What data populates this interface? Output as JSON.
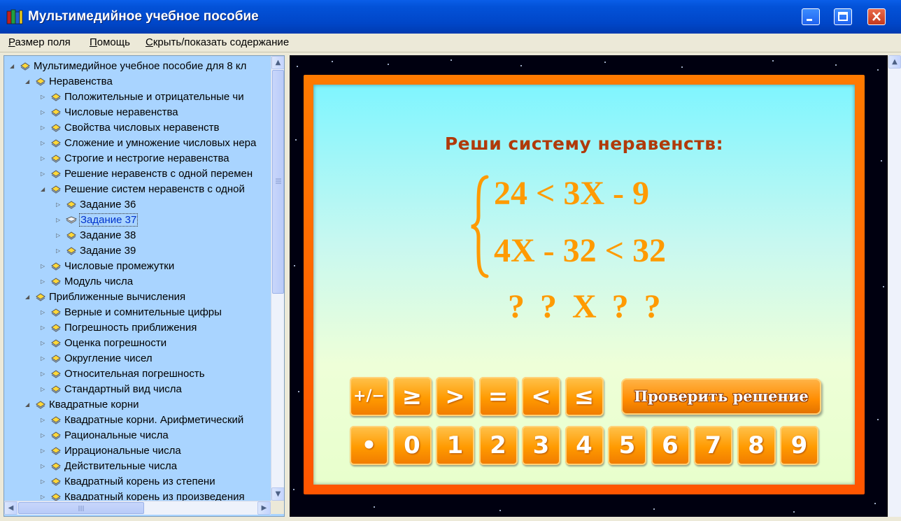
{
  "window": {
    "title": "Мультимедийное учебное пособие"
  },
  "menu": [
    {
      "label": "Размер поля",
      "underline": "Р",
      "rest": "азмер поля"
    },
    {
      "label": "Помощь",
      "underline": "П",
      "rest": "омощь"
    },
    {
      "label": "Скрыть/показать содержание",
      "underline": "С",
      "rest": "крыть/показать содержание"
    }
  ],
  "tree": {
    "items": [
      {
        "label": "Мультимедийное учебное пособие для 8 кл",
        "level": 0,
        "expanded": true
      },
      {
        "label": "Неравенства",
        "level": 1,
        "expanded": true
      },
      {
        "label": "Положительные и отрицательные чи",
        "level": 2
      },
      {
        "label": "Числовые неравенства",
        "level": 2
      },
      {
        "label": "Свойства числовых неравенств",
        "level": 2
      },
      {
        "label": "Сложение и умножение числовых нера",
        "level": 2
      },
      {
        "label": "Строгие и нестрогие неравенства",
        "level": 2
      },
      {
        "label": "Решение неравенств с одной перемен",
        "level": 2
      },
      {
        "label": "Решение систем неравенств с одной",
        "level": 2,
        "expanded": true
      },
      {
        "label": "Задание 36",
        "level": 3
      },
      {
        "label": "Задание 37",
        "level": 3,
        "selected": true
      },
      {
        "label": "Задание 38",
        "level": 3
      },
      {
        "label": "Задание 39",
        "level": 3
      },
      {
        "label": "Числовые промежутки",
        "level": 2
      },
      {
        "label": "Модуль числа",
        "level": 2
      },
      {
        "label": "Приближенные вычисления",
        "level": 1,
        "expanded": true
      },
      {
        "label": "Верные и сомнительные цифры",
        "level": 2
      },
      {
        "label": "Погрешность приближения",
        "level": 2
      },
      {
        "label": "Оценка погрешности",
        "level": 2
      },
      {
        "label": "Округление чисел",
        "level": 2
      },
      {
        "label": "Относительная погрешность",
        "level": 2
      },
      {
        "label": "Стандартный вид числа",
        "level": 2
      },
      {
        "label": "Квадратные корни",
        "level": 1,
        "expanded": true
      },
      {
        "label": "Квадратные корни. Арифметический",
        "level": 2
      },
      {
        "label": "Рациональные числа",
        "level": 2
      },
      {
        "label": "Иррациональные числа",
        "level": 2
      },
      {
        "label": "Действительные числа",
        "level": 2
      },
      {
        "label": "Квадратный корень из степени",
        "level": 2
      },
      {
        "label": "Квадратный корень из произведения",
        "level": 2
      }
    ]
  },
  "task": {
    "prompt": "Реши систему неравенств:",
    "line1": "24 < 3X - 9",
    "line2": "4X - 32 < 32",
    "answer": "? ? X ? ?"
  },
  "keypad": {
    "symbols": [
      "+/−",
      "≥",
      ">",
      "=",
      "<",
      "≤"
    ],
    "digits": [
      "•",
      "0",
      "1",
      "2",
      "3",
      "4",
      "5",
      "6",
      "7",
      "8",
      "9"
    ],
    "check_label": "Проверить решение"
  },
  "colors": {
    "titlebar": "#0054e3",
    "tree_background": "#a9d4ff",
    "frame_orange": "#ff6a00",
    "equation_orange": "#ff9a00",
    "prompt_brown": "#b03a0a"
  }
}
